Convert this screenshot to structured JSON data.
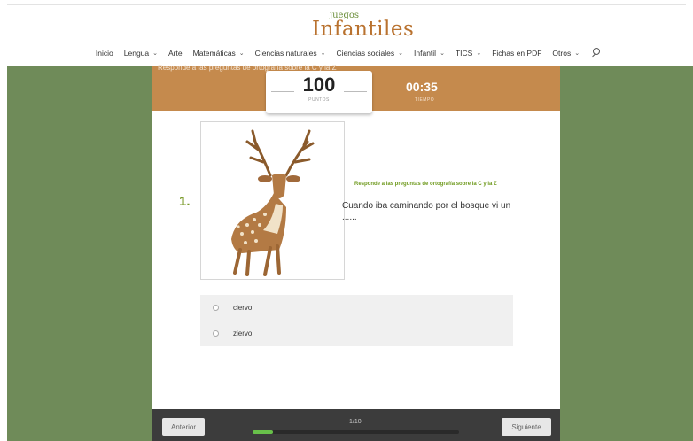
{
  "header": {
    "logo_small": "juegos",
    "logo_big": "Infantiles",
    "nav": [
      {
        "label": "Inicio",
        "dropdown": false
      },
      {
        "label": "Lengua",
        "dropdown": true
      },
      {
        "label": "Arte",
        "dropdown": false
      },
      {
        "label": "Matemáticas",
        "dropdown": true
      },
      {
        "label": "Ciencias naturales",
        "dropdown": true
      },
      {
        "label": "Ciencias sociales",
        "dropdown": true
      },
      {
        "label": "Infantil",
        "dropdown": true
      },
      {
        "label": "TICS",
        "dropdown": true
      },
      {
        "label": "Fichas en PDF",
        "dropdown": false
      },
      {
        "label": "Otros",
        "dropdown": true
      }
    ],
    "search_icon": "search-icon"
  },
  "quiz": {
    "title": "Responde a las preguntas de ortografía sobre la C y la Z",
    "score": "100",
    "score_label": "PUNTOS",
    "timer": "00:35",
    "timer_label": "TIEMPO",
    "question_number": "1.",
    "question_subtitle": "Responde a las preguntas de ortografía sobre la C y la Z",
    "question_text": "Cuando iba caminando por el bosque vi un ......",
    "image_icon": "deer-illustration",
    "options": [
      "ciervo",
      "zierv o"
    ],
    "footer": {
      "prev_label": "Anterior",
      "next_label": "Siguiente",
      "progress_text": "1/10",
      "progress_fraction": 0.1
    }
  },
  "colors": {
    "bar": "#c58a4d",
    "background": "#6f8b59",
    "accent_green": "#7a9a2a",
    "progress": "#68c04a"
  }
}
